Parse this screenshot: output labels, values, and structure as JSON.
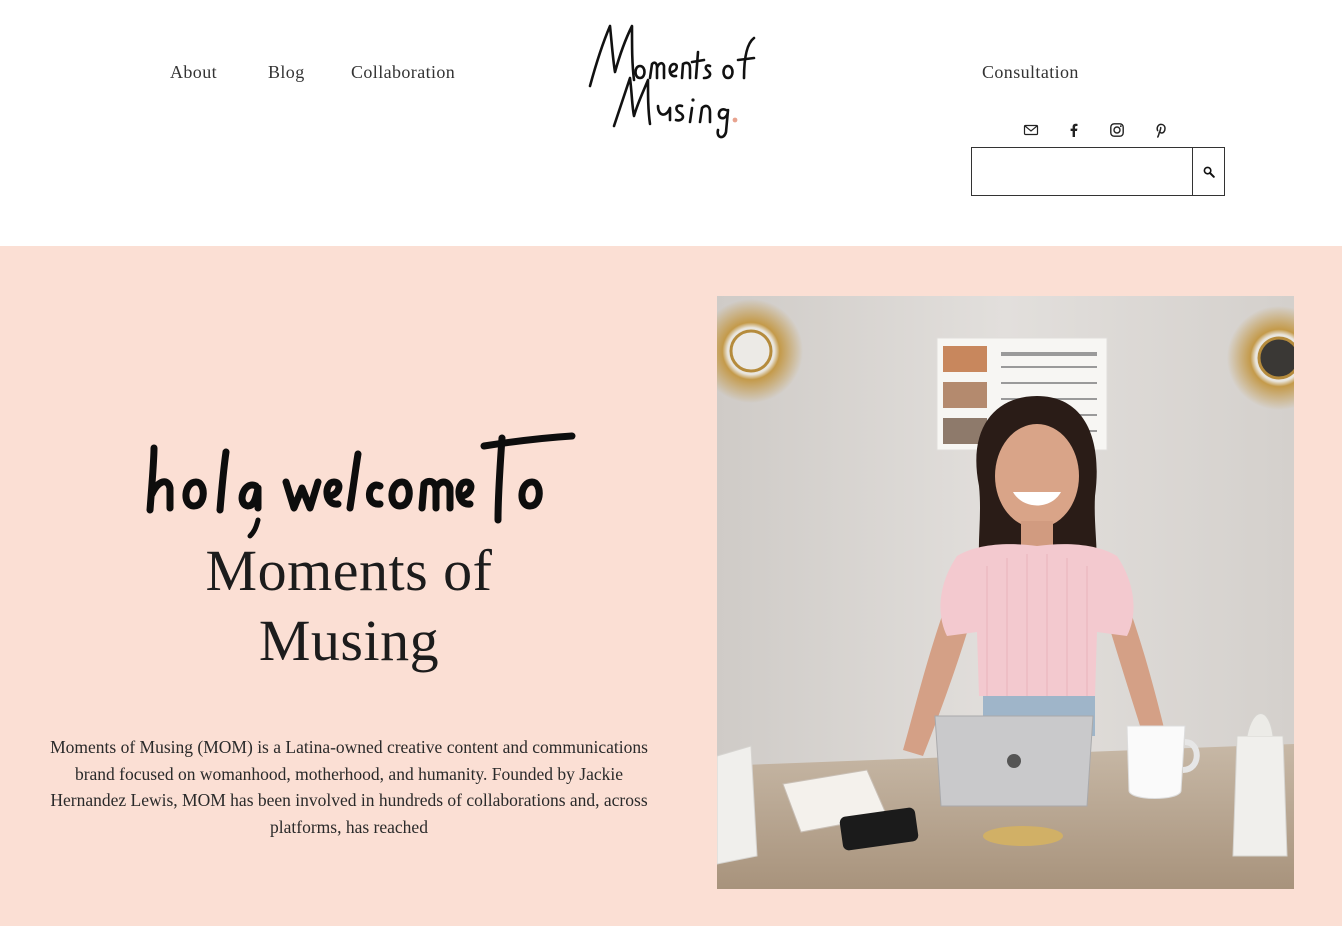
{
  "nav": {
    "about": "About",
    "blog": "Blog",
    "collaboration": "Collaboration",
    "consultation": "Consultation"
  },
  "logo": {
    "line1": "Moments of",
    "line2": "Musing"
  },
  "social": [
    "email-icon",
    "facebook-icon",
    "instagram-icon",
    "pinterest-icon"
  ],
  "search": {
    "placeholder": "",
    "value": "",
    "button_icon": "search-icon"
  },
  "hero": {
    "greeting": "hola, welcome to",
    "title_line1": "Moments of",
    "title_line2": "Musing",
    "description": "Moments of Musing (MOM) is a Latina-owned creative content and communications brand focused on womanhood, motherhood, and humanity. Founded by Jackie Hernandez Lewis, MOM has been involved in hundreds of collaborations and, across platforms, has reached",
    "photo_alt": "Woman in pink top smiling at a desk with a laptop"
  },
  "colors": {
    "hero_bg": "#fbdfd4",
    "text": "#222222",
    "accent": "#e8a38f"
  }
}
